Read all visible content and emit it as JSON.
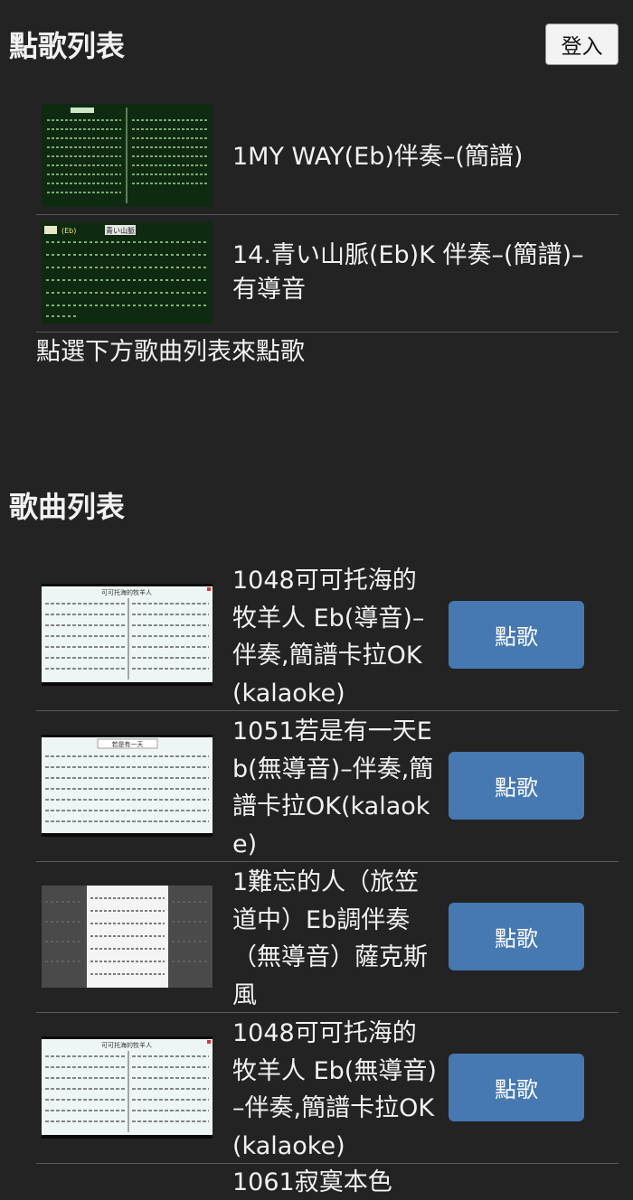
{
  "header": {
    "title": "點歌列表",
    "login_label": "登入"
  },
  "queue": {
    "items": [
      {
        "title": "1MY WAY(Eb)伴奏–(簡譜)",
        "thumb_theme": "dark-green"
      },
      {
        "title": "14.青い山脈(Eb)K 伴奏–(簡譜)–有導音",
        "thumb_theme": "dark-green",
        "thumb_badge": "青い山脈",
        "thumb_key": "(Eb)"
      }
    ],
    "hint": "點選下方歌曲列表來點歌"
  },
  "songs": {
    "title": "歌曲列表",
    "button_label": "點歌",
    "items": [
      {
        "title": "1048可可托海的牧羊人 Eb(導音)–伴奏,簡譜卡拉OK(kalaoke)",
        "thumb_theme": "light",
        "thumb_heading": "可可托海的牧羊人"
      },
      {
        "title": "1051若是有一天Eb(無導音)–伴奏,簡譜卡拉OK(kalaoke)",
        "thumb_theme": "light",
        "thumb_heading": "若是有一天"
      },
      {
        "title": "1難忘的人（旅笠道中）Eb調伴奏（無導音）薩克斯風",
        "thumb_theme": "gray"
      },
      {
        "title": "1048可可托海的牧羊人 Eb(無導音)–伴奏,簡譜卡拉OK(kalaoke)",
        "thumb_theme": "light",
        "thumb_heading": "可可托海的牧羊人"
      }
    ],
    "partial_next": "1061寂寞本色"
  },
  "colors": {
    "background": "#232323",
    "button": "#4678b2",
    "divider": "#5a5a5a",
    "thumb_dark": "#0e2a10"
  }
}
